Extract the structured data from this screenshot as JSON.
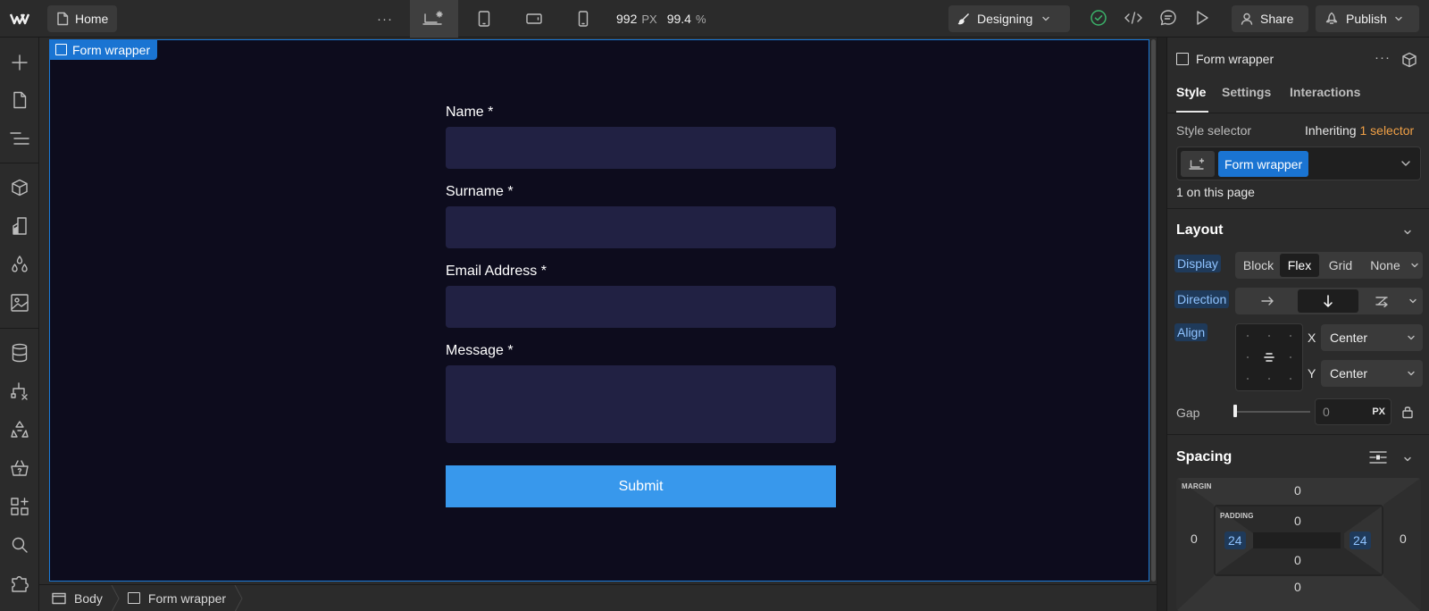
{
  "topbar": {
    "home_label": "Home",
    "more_label": "···",
    "viewport_width": "992",
    "viewport_unit": "PX",
    "zoom": "99.4",
    "zoom_unit": "%",
    "mode_label": "Designing",
    "share_label": "Share",
    "publish_label": "Publish"
  },
  "canvas": {
    "selection_tag": "Form wrapper",
    "form": {
      "fields": [
        {
          "label": "Name *"
        },
        {
          "label": "Surname *"
        },
        {
          "label": "Email Address *"
        },
        {
          "label": "Message *"
        }
      ],
      "submit_label": "Submit"
    }
  },
  "breadcrumb": {
    "items": [
      {
        "label": "Body"
      },
      {
        "label": "Form wrapper"
      }
    ]
  },
  "panel": {
    "element_name": "Form wrapper",
    "more_label": "···",
    "tabs": [
      {
        "label": "Style",
        "active": true
      },
      {
        "label": "Settings",
        "active": false
      },
      {
        "label": "Interactions",
        "active": false
      }
    ],
    "style_selector_label": "Style selector",
    "inheriting_label": "Inheriting",
    "inheriting_count": "1 selector",
    "selector_chip": "Form wrapper",
    "on_page_label": "1 on this page",
    "layout": {
      "title": "Layout",
      "display_label": "Display",
      "display_options": [
        "Block",
        "Flex",
        "Grid",
        "None"
      ],
      "display_selected": "Flex",
      "direction_label": "Direction",
      "direction_selected": "vertical",
      "align_label": "Align",
      "align_x_label": "X",
      "align_x_value": "Center",
      "align_y_label": "Y",
      "align_y_value": "Center",
      "gap_label": "Gap",
      "gap_value": "0",
      "gap_unit": "PX"
    },
    "spacing": {
      "title": "Spacing",
      "margin_label": "MARGIN",
      "padding_label": "PADDING",
      "margin_top": "0",
      "margin_right": "0",
      "margin_bottom": "0",
      "margin_left": "0",
      "padding_top": "0",
      "padding_right": "24",
      "padding_bottom": "0",
      "padding_left": "24"
    }
  },
  "colors": {
    "canvas_bg": "#0d0c1d",
    "input_bg": "#212143",
    "submit_bg": "#3898ec",
    "selection_blue": "#1a74d2",
    "panel_bg": "#2b2b2b"
  }
}
